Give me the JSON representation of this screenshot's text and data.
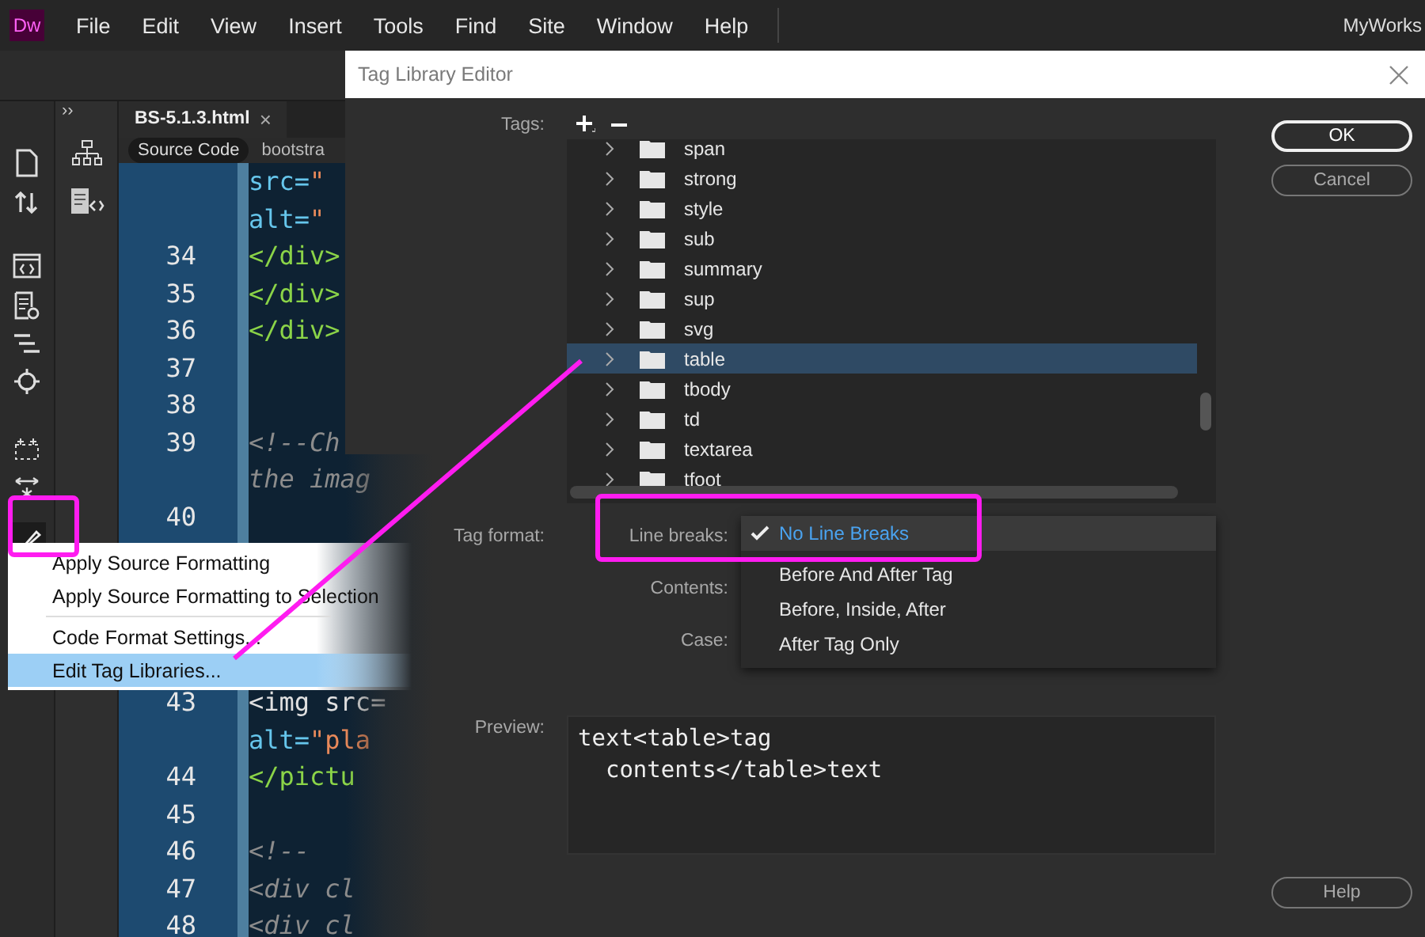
{
  "menu_bar": {
    "app_badge": "Dw",
    "items": [
      "File",
      "Edit",
      "View",
      "Insert",
      "Tools",
      "Find",
      "Site",
      "Window",
      "Help"
    ],
    "workspace": "MyWorks"
  },
  "panel_toggle": "››",
  "document_tab": {
    "title": "BS-5.1.3.html",
    "close": "×"
  },
  "view_tabs": [
    {
      "label": "Source Code",
      "selected": true
    },
    {
      "label": "bootstra",
      "selected": false
    }
  ],
  "code_lines_top": [
    {
      "kind": "attr",
      "text": "src=",
      "value": "\""
    },
    {
      "kind": "attr",
      "text": "alt=",
      "value": "\""
    },
    {
      "number": "34",
      "kind": "tag",
      "text": "</div>"
    },
    {
      "number": "35",
      "kind": "tag",
      "text": "</div>"
    },
    {
      "number": "36",
      "kind": "tag",
      "text": "</div>"
    },
    {
      "number": "37"
    },
    {
      "number": "38"
    },
    {
      "number": "39",
      "kind": "comment",
      "text": "<!--Ch"
    },
    {
      "kind": "comment",
      "text": "the imag"
    },
    {
      "number": "40"
    }
  ],
  "code_lines_bottom": [
    {
      "number": "43",
      "kind": "plain",
      "text": "<img src="
    },
    {
      "kind": "attr",
      "text": "alt=",
      "value": "\"pla"
    },
    {
      "number": "44",
      "kind": "tag",
      "text": "</pictu"
    },
    {
      "number": "45"
    },
    {
      "number": "46",
      "kind": "comment",
      "text": "<!--"
    },
    {
      "number": "47",
      "kind": "comment",
      "text": "<div cl"
    },
    {
      "number": "48",
      "kind": "comment",
      "text": "<div cl"
    }
  ],
  "context_menu": [
    {
      "label": "Apply Source Formatting",
      "selected": false,
      "separator_before": false
    },
    {
      "label": "Apply Source Formatting to Selection",
      "selected": false,
      "separator_before": false
    },
    {
      "label": "Code Format Settings...",
      "selected": false,
      "separator_before": true
    },
    {
      "label": "Edit Tag Libraries...",
      "selected": true,
      "separator_before": false
    }
  ],
  "dialog": {
    "title": "Tag Library Editor",
    "tags_label": "Tags:",
    "tags": [
      {
        "label": "span",
        "selected": false
      },
      {
        "label": "strong",
        "selected": false
      },
      {
        "label": "style",
        "selected": false
      },
      {
        "label": "sub",
        "selected": false
      },
      {
        "label": "summary",
        "selected": false
      },
      {
        "label": "sup",
        "selected": false
      },
      {
        "label": "svg",
        "selected": false
      },
      {
        "label": "table",
        "selected": true
      },
      {
        "label": "tbody",
        "selected": false
      },
      {
        "label": "td",
        "selected": false
      },
      {
        "label": "textarea",
        "selected": false
      },
      {
        "label": "tfoot",
        "selected": false
      }
    ],
    "tag_format_label": "Tag format:",
    "line_breaks_label": "Line breaks:",
    "line_break_options": [
      {
        "label": "No Line Breaks",
        "selected": true
      },
      {
        "label": "Before And After Tag",
        "selected": false
      },
      {
        "label": "Before, Inside, After",
        "selected": false
      },
      {
        "label": "After Tag Only",
        "selected": false
      }
    ],
    "contents_label": "Contents:",
    "case_label": "Case:",
    "preview_label": "Preview:",
    "preview_lines": [
      "text<table>tag",
      "  contents</table>text"
    ],
    "buttons": [
      {
        "label": "OK",
        "kind": "primary"
      },
      {
        "label": "Cancel",
        "kind": "secondary"
      }
    ],
    "help_button": "Help"
  }
}
